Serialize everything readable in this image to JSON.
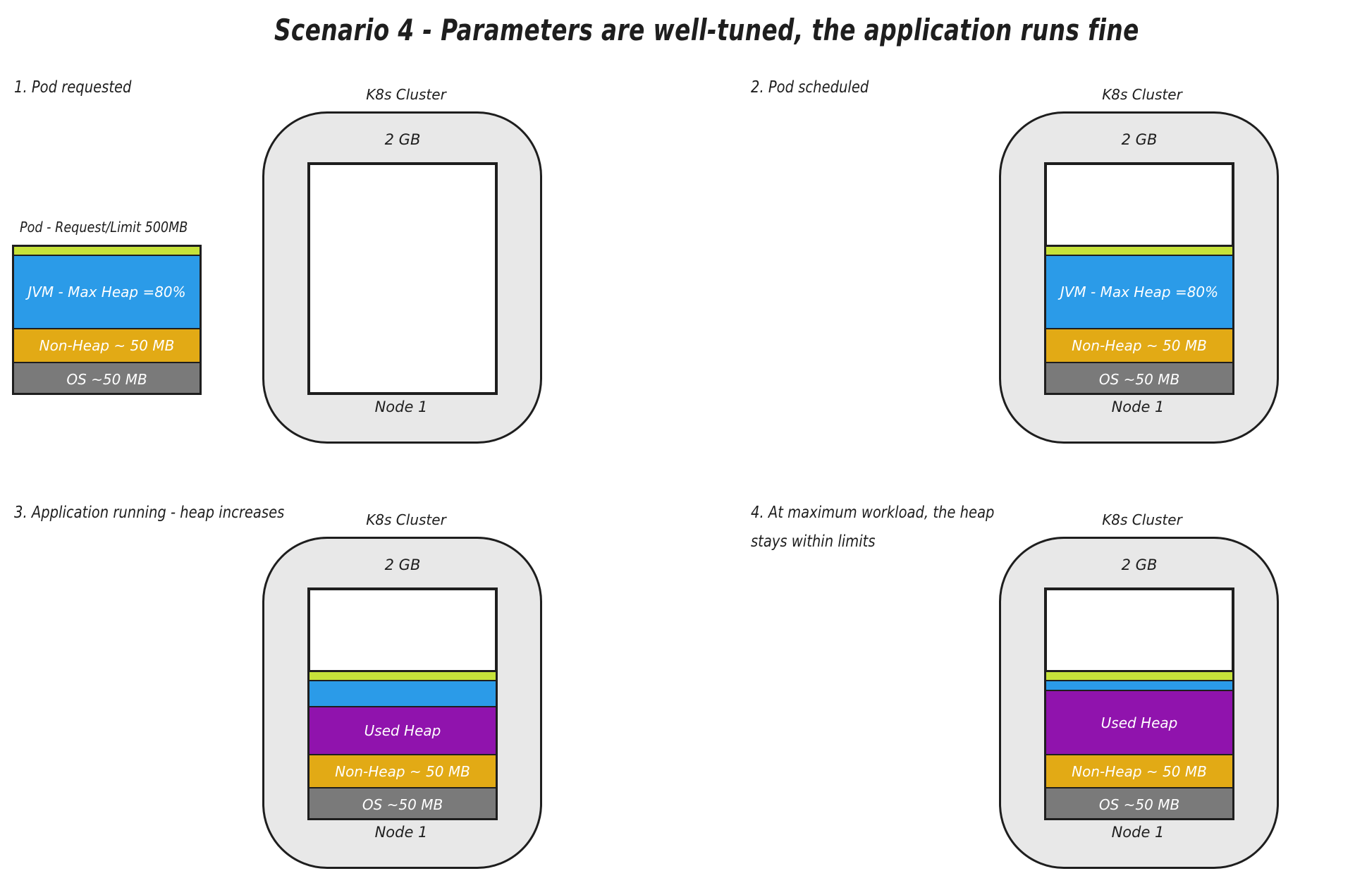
{
  "title": "Scenario 4 - Parameters are well-tuned, the application runs fine",
  "colors": {
    "limit_bar": "#c6e23a",
    "jvm_heap": "#2b9be8",
    "non_heap": "#e2aa15",
    "os": "#7a7a7a",
    "used_heap": "#9013ad",
    "cluster_bg": "#e8e8e8"
  },
  "pod": {
    "label": "Pod - Request/Limit 500MB",
    "jvm": "JVM - Max Heap =80%",
    "non_heap": "Non-Heap ~ 50 MB",
    "os": "OS ~50 MB"
  },
  "panels": [
    {
      "step": "1. Pod requested",
      "cluster_label": "K8s Cluster",
      "memory": "2 GB",
      "node": "Node 1"
    },
    {
      "step": "2. Pod scheduled",
      "cluster_label": "K8s Cluster",
      "memory": "2 GB",
      "node": "Node 1",
      "jvm": "JVM - Max Heap =80%",
      "non_heap": "Non-Heap ~ 50 MB",
      "os": "OS ~50 MB"
    },
    {
      "step": "3. Application running - heap increases",
      "cluster_label": "K8s Cluster",
      "memory": "2 GB",
      "node": "Node 1",
      "used_heap": "Used Heap",
      "non_heap": "Non-Heap ~ 50 MB",
      "os": "OS ~50 MB"
    },
    {
      "step_line1": "4. At maximum workload, the heap",
      "step_line2": "stays within limits",
      "cluster_label": "K8s Cluster",
      "memory": "2 GB",
      "node": "Node 1",
      "used_heap": "Used Heap",
      "non_heap": "Non-Heap ~ 50 MB",
      "os": "OS ~50 MB"
    }
  ]
}
